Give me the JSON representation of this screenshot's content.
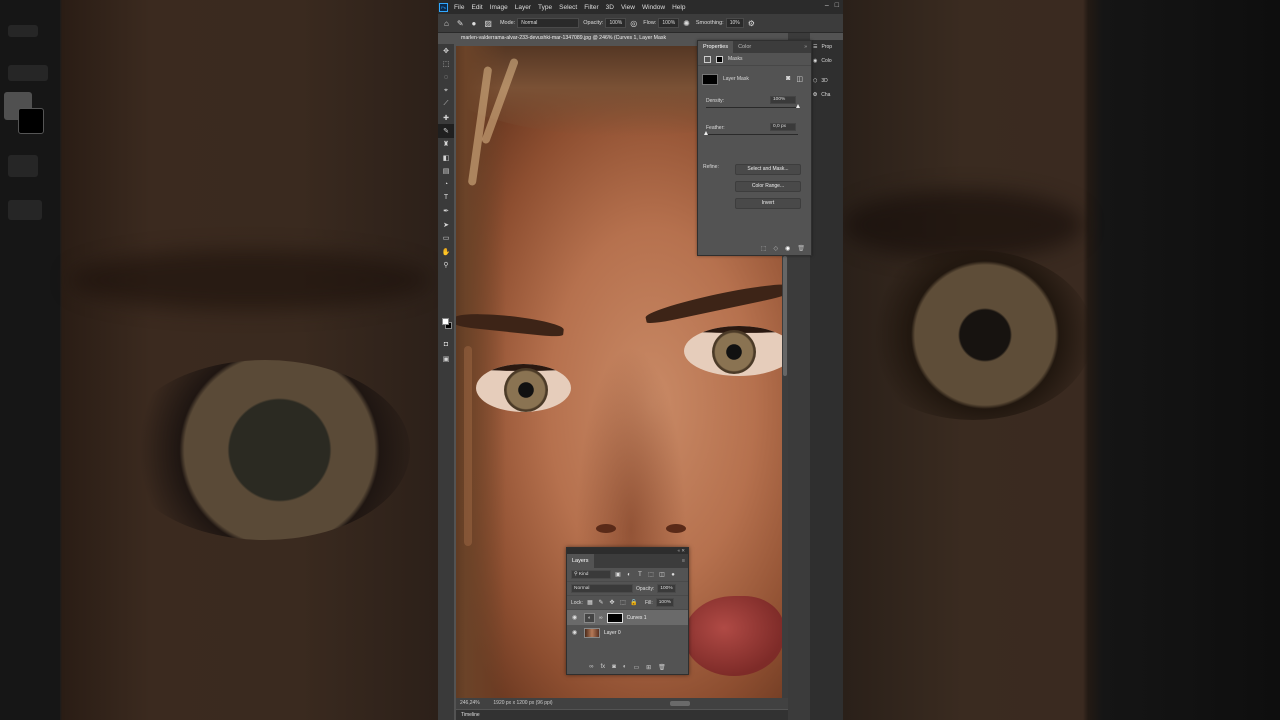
{
  "menubar": {
    "items": [
      "File",
      "Edit",
      "Image",
      "Layer",
      "Type",
      "Select",
      "Filter",
      "3D",
      "View",
      "Window",
      "Help"
    ]
  },
  "options": {
    "mode_label": "Mode:",
    "mode_value": "Normal",
    "opacity_label": "Opacity:",
    "opacity_value": "100%",
    "flow_label": "Flow:",
    "flow_value": "100%",
    "smoothing_label": "Smoothing:",
    "smoothing_value": "10%"
  },
  "document": {
    "tab_title": "marlen-valderrama-alvar-233-devushki-mar-1347089.jpg @ 246% (Curves 1, Layer Mask",
    "zoom": "246,24%",
    "dimensions": "1920 px x 1200 px (96 ppi)"
  },
  "timeline": {
    "label": "Timeline"
  },
  "right_dock": {
    "items": [
      {
        "label": "Prop"
      },
      {
        "label": "Colo"
      },
      {
        "label": "3D"
      },
      {
        "label": "Cha"
      }
    ]
  },
  "properties": {
    "tabs": [
      "Properties",
      "Color"
    ],
    "masks_label": "Masks",
    "layer_mask_label": "Layer Mask",
    "density_label": "Density:",
    "density_value": "100%",
    "density_level": 1.0,
    "feather_label": "Feather:",
    "feather_value": "0,0 px",
    "feather_level": 0.0,
    "refine_label": "Refine:",
    "buttons": {
      "select_and_mask": "Select and Mask...",
      "color_range": "Color Range...",
      "invert": "Invert"
    }
  },
  "layers": {
    "tab": "Layers",
    "filter_kind": "Kind",
    "blend_mode": "Normal",
    "opacity_label": "Opacity:",
    "opacity_value": "100%",
    "lock_label": "Lock:",
    "fill_label": "Fill:",
    "fill_value": "100%",
    "items": [
      {
        "name": "Curves 1",
        "selected": true
      },
      {
        "name": "Layer 0",
        "selected": false
      }
    ]
  },
  "icons": {
    "toolbar": [
      "move-icon",
      "marquee-icon",
      "lasso-icon",
      "quick-select-icon",
      "eyedropper-icon",
      "healing-brush-icon",
      "brush-icon",
      "clone-stamp-icon",
      "eraser-icon",
      "gradient-icon",
      "dodge-icon",
      "type-icon",
      "pen-icon",
      "path-select-icon",
      "rectangle-icon",
      "hand-icon",
      "zoom-icon"
    ]
  },
  "colors": {
    "panel_bg": "#535353",
    "dark_bar": "#2b2b2b",
    "accent": "#31a8ff"
  }
}
